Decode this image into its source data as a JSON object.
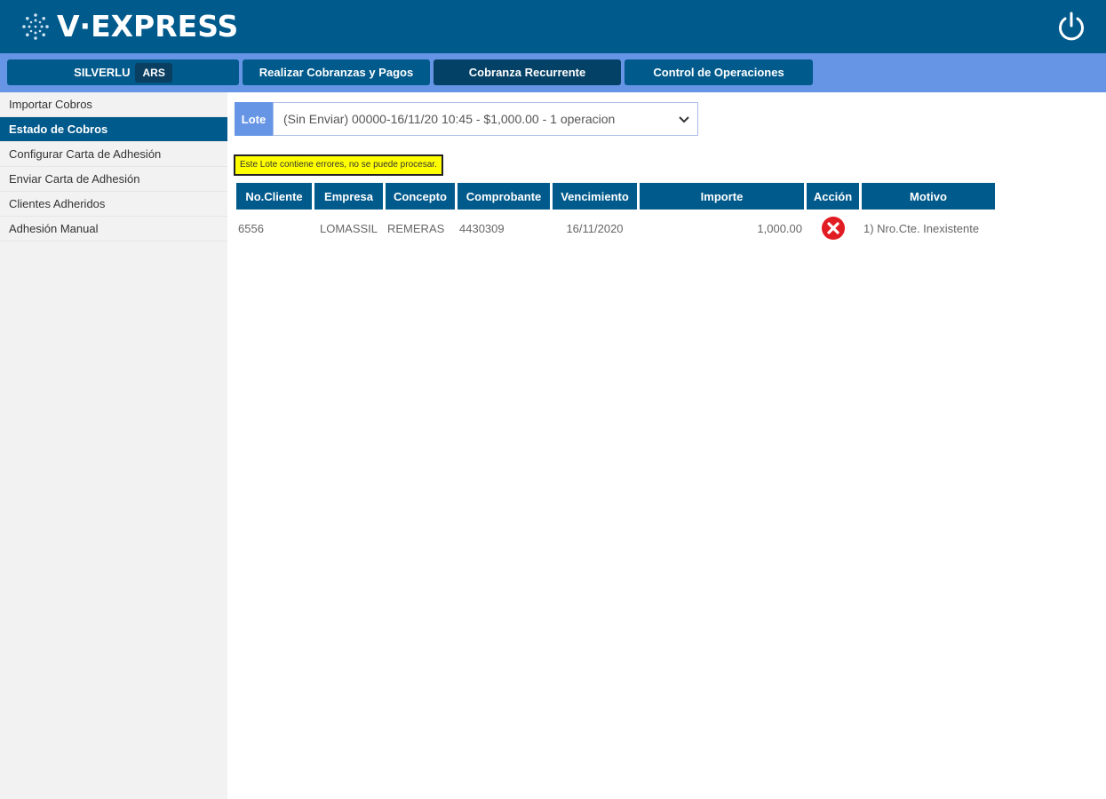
{
  "brand": {
    "name": "V·EXPRESS",
    "logo_icon": "globe-dots-icon"
  },
  "header": {
    "power_icon": "power-icon"
  },
  "nav": {
    "user": "SILVERLU",
    "currency": "ARS",
    "buttons": [
      {
        "label": "Realizar Cobranzas y Pagos"
      },
      {
        "label": "Cobranza Recurrente",
        "active": true
      },
      {
        "label": "Control de Operaciones"
      }
    ]
  },
  "sidebar": {
    "items": [
      {
        "label": "Importar Cobros"
      },
      {
        "label": "Estado de Cobros",
        "active": true
      },
      {
        "label": "Configurar Carta de Adhesión"
      },
      {
        "label": "Enviar Carta de Adhesión"
      },
      {
        "label": "Clientes Adheridos"
      },
      {
        "label": "Adhesión Manual"
      }
    ]
  },
  "lote": {
    "label": "Lote",
    "selected": "(Sin Enviar) 00000-16/11/20 10:45 - $1,000.00 - 1 operacion"
  },
  "warning": "Este Lote contiene errores, no se puede procesar.",
  "table": {
    "headers": [
      "No.Cliente",
      "Empresa",
      "Concepto",
      "Comprobante",
      "Vencimiento",
      "Importe",
      "Acción",
      "Motivo"
    ],
    "rows": [
      {
        "cliente": "6556",
        "empresa": "LOMASSIL",
        "concepto": "REMERAS",
        "comprobante": "4430309",
        "vencimiento": "16/11/2020",
        "importe": "1,000.00",
        "accion_icon": "error-x-icon",
        "motivo": "1) Nro.Cte. Inexistente"
      }
    ]
  },
  "colors": {
    "header": "#005a8c",
    "navbar": "#6595e4",
    "sidebar": "#f2f2f2",
    "warning": "#ffff00",
    "error": "#e21c23"
  }
}
